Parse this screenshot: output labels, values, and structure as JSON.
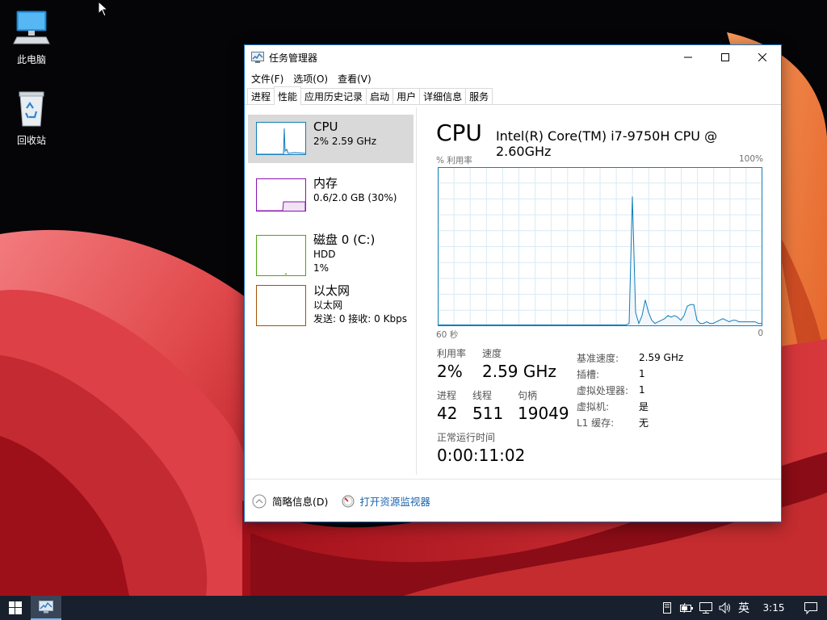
{
  "desktop": {
    "icons": [
      {
        "label": "此电脑",
        "icon": "computer-icon"
      },
      {
        "label": "回收站",
        "icon": "recycle-bin-icon"
      }
    ]
  },
  "window": {
    "title": "任务管理器",
    "menu": [
      "文件(F)",
      "选项(O)",
      "查看(V)"
    ],
    "tabs": [
      "进程",
      "性能",
      "应用历史记录",
      "启动",
      "用户",
      "详细信息",
      "服务"
    ],
    "active_tab": "性能"
  },
  "resources": [
    {
      "name": "CPU",
      "lines": [
        "2% 2.59 GHz"
      ],
      "color": "#117dbb",
      "selected": true
    },
    {
      "name": "内存",
      "lines": [
        "0.6/2.0 GB (30%)"
      ],
      "color": "#8b12ae",
      "selected": false
    },
    {
      "name": "磁盘 0 (C:)",
      "lines": [
        "HDD",
        "1%"
      ],
      "color": "#4da60c",
      "selected": false
    },
    {
      "name": "以太网",
      "lines": [
        "以太网",
        "发送: 0 接收: 0 Kbps"
      ],
      "color": "#a74f01",
      "selected": false
    }
  ],
  "cpu": {
    "heading": "CPU",
    "model": "Intel(R) Core(TM) i7-9750H CPU @ 2.60GHz",
    "graph_label": "% 利用率",
    "graph_max": "100%",
    "time_left": "60 秒",
    "time_right": "0",
    "utilization_label": "利用率",
    "utilization": "2%",
    "speed_label": "速度",
    "speed": "2.59 GHz",
    "processes_label": "进程",
    "processes": "42",
    "threads_label": "线程",
    "threads": "511",
    "handles_label": "句柄",
    "handles": "19049",
    "uptime_label": "正常运行时间",
    "uptime": "0:00:11:02",
    "specs": [
      {
        "key": "基准速度:",
        "value": "2.59 GHz"
      },
      {
        "key": "插槽:",
        "value": "1"
      },
      {
        "key": "虚拟处理器:",
        "value": "1"
      },
      {
        "key": "虚拟机:",
        "value": "是"
      },
      {
        "key": "L1 缓存:",
        "value": "无"
      }
    ]
  },
  "chart_data": {
    "type": "line",
    "title": "",
    "xlabel": "",
    "ylabel": "% 利用率",
    "x_label_left": "60 秒",
    "x_label_right": "0",
    "ylim": [
      0,
      100
    ],
    "series": [
      {
        "values": [
          0,
          0,
          0,
          0,
          0,
          0,
          0,
          0,
          0,
          0,
          0,
          0,
          0,
          0,
          0,
          0,
          0,
          0,
          0,
          0,
          0,
          0,
          0,
          0,
          0,
          0,
          0,
          0,
          0,
          0,
          0,
          0,
          0,
          0,
          0,
          0,
          0,
          0,
          0,
          0,
          0,
          0,
          0,
          0,
          0,
          0,
          0,
          0,
          0,
          0,
          0,
          0,
          0,
          0,
          0,
          0,
          0,
          0,
          0,
          1,
          82,
          8,
          1,
          6,
          16,
          8,
          3,
          1,
          2,
          3,
          4,
          6,
          5,
          6,
          5,
          3,
          6,
          12,
          13,
          13,
          3,
          1,
          1,
          2,
          1,
          1,
          2,
          3,
          4,
          3,
          2,
          3,
          3,
          2,
          2,
          2,
          2,
          2,
          2,
          1,
          1
        ]
      }
    ],
    "color": "#117dbb"
  },
  "footer": {
    "summary": "简略信息(D)",
    "monitor": "打开资源监视器"
  },
  "taskbar": {
    "ime": "英",
    "time": "3:15"
  }
}
